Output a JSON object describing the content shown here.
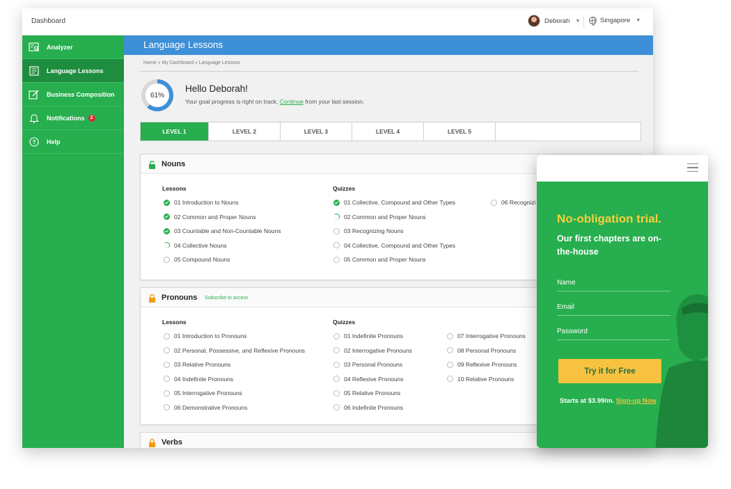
{
  "topbar": {
    "title": "Dashboard",
    "user_name": "Deborah",
    "region": "Singapore"
  },
  "sidebar": {
    "items": [
      {
        "label": "Analyzer",
        "icon": "analyzer-icon"
      },
      {
        "label": "Language Lessons",
        "icon": "book-icon",
        "active": true
      },
      {
        "label": "Business Composition",
        "icon": "edit-icon"
      },
      {
        "label": "Notifications",
        "icon": "bell-icon",
        "badge": "2"
      },
      {
        "label": "Help",
        "icon": "help-icon"
      }
    ]
  },
  "page": {
    "title": "Language Lessons",
    "breadcrumb": "Home » My Dashboard » Language Lessons",
    "progress": {
      "label": "61%",
      "value": 0.61
    },
    "greeting": "Hello Deborah!",
    "goal_prefix": "Your goal progress is right on track.",
    "goal_link": "Continue",
    "goal_suffix": "from your last session."
  },
  "levels": [
    "LEVEL 1",
    "LEVEL 2",
    "LEVEL 3",
    "LEVEL 4",
    "LEVEL 5"
  ],
  "sections": {
    "nouns": {
      "title": "Nouns",
      "lessons_header": "Lessons",
      "quizzes_header": "Quizzes",
      "lessons": [
        {
          "label": "01  Introduction to Nouns",
          "status": "done"
        },
        {
          "label": "02  Common and Proper Nouns",
          "status": "done"
        },
        {
          "label": "03  Countable and Non-Countable Nouns",
          "status": "done"
        },
        {
          "label": "04  Collective Nouns",
          "status": "progress"
        },
        {
          "label": "05  Compound Nouns",
          "status": "todo"
        }
      ],
      "quizzes": [
        {
          "label": "01  Collective, Compound and Other Types",
          "status": "done"
        },
        {
          "label": "02  Common and Proper Nouns",
          "status": "progress"
        },
        {
          "label": "03  Recognizing Nouns",
          "status": "todo"
        },
        {
          "label": "04  Collective, Compound and Other Types",
          "status": "todo"
        },
        {
          "label": "05  Common and Proper Nouns",
          "status": "todo"
        }
      ],
      "quizzes_col3": [
        {
          "label": "06  Recognizi",
          "status": "todo"
        }
      ]
    },
    "pronouns": {
      "title": "Pronouns",
      "subtitle": "Subscribe to access",
      "lessons_header": "Lessons",
      "quizzes_header": "Quizzes",
      "lessons": [
        {
          "label": "01  Introduction to Pronouns",
          "status": "todo"
        },
        {
          "label": "02  Personal, Possessive, and Reflexive Pronouns",
          "status": "todo"
        },
        {
          "label": "03  Relative Pronouns",
          "status": "todo"
        },
        {
          "label": "04  Indefinite Pronouns",
          "status": "todo"
        },
        {
          "label": "05  Interrogative Pronouns",
          "status": "todo"
        },
        {
          "label": "06  Demonstrative Pronouns",
          "status": "todo"
        }
      ],
      "quizzes": [
        {
          "label": "01  Indefinite Pronouns",
          "status": "todo"
        },
        {
          "label": "02  Interrogative Pronouns",
          "status": "todo"
        },
        {
          "label": "03 Personal Pronouns",
          "status": "todo"
        },
        {
          "label": "04  Reflexive Pronouns",
          "status": "todo"
        },
        {
          "label": "05  Relative Pronouns",
          "status": "todo"
        },
        {
          "label": "06  Indefinite Pronouns",
          "status": "todo"
        }
      ],
      "quizzes_col3": [
        {
          "label": "07  Interrogative Pronouns",
          "status": "todo"
        },
        {
          "label": "08  Personal Pronouns",
          "status": "todo"
        },
        {
          "label": "09  Reflexive Pronouns",
          "status": "todo"
        },
        {
          "label": "10  Relative Pronouns",
          "status": "todo"
        }
      ]
    },
    "verbs": {
      "title": "Verbs"
    }
  },
  "mobile": {
    "headline": "No-obligation trial.",
    "subheadline": "Our first chapters are on-the-house",
    "fields": [
      "Name",
      "Email",
      "Password"
    ],
    "cta": "Try it for Free",
    "price_text": "Starts at $3.99/m.",
    "price_link": "Sign-up Now"
  },
  "colors": {
    "green": "#27ae4e",
    "dark_green": "#1f8d3f",
    "blue": "#3d8fd8",
    "yellow": "#f6c23f",
    "lock_orange": "#f39c12",
    "badge_red": "#e3262f"
  }
}
